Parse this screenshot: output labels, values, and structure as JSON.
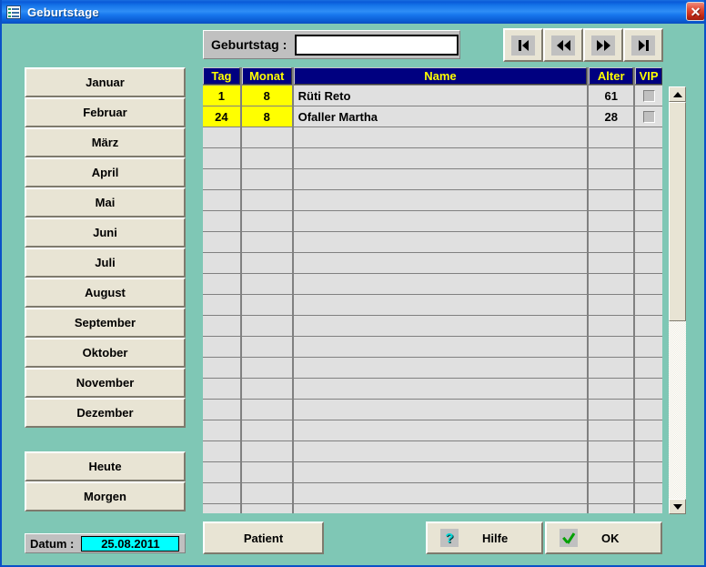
{
  "window": {
    "title": "Geburtstage",
    "icon": "list-icon",
    "close_label": "✕",
    "bg_color": "#7fc7b5",
    "titlebar_color": "#0a5ad8"
  },
  "search": {
    "label": "Geburtstag :",
    "value": "",
    "placeholder": ""
  },
  "nav": [
    {
      "name": "first-record-button",
      "icon": "go-first-icon"
    },
    {
      "name": "previous-record-button",
      "icon": "go-previous-icon"
    },
    {
      "name": "next-record-button",
      "icon": "go-next-icon"
    },
    {
      "name": "last-record-button",
      "icon": "go-last-icon"
    }
  ],
  "months": [
    "Januar",
    "Februar",
    "März",
    "April",
    "Mai",
    "Juni",
    "Juli",
    "August",
    "September",
    "Oktober",
    "November",
    "Dezember"
  ],
  "day_buttons": [
    "Heute",
    "Morgen"
  ],
  "datum": {
    "label": "Datum :",
    "value": "25.08.2011",
    "field_color": "#00ffff"
  },
  "table": {
    "header_bg": "#000080",
    "header_fg": "#ffff00",
    "highlight_color": "#ffff00",
    "columns": [
      "Tag",
      "Monat",
      "Name",
      "Alter",
      "VIP"
    ],
    "rows": [
      {
        "tag": "1",
        "monat": "8",
        "name": "Rüti Reto",
        "alter": "61",
        "vip": false,
        "highlight": true
      },
      {
        "tag": "24",
        "monat": "8",
        "name": "Ofaller Martha",
        "alter": "28",
        "vip": false,
        "highlight": true
      }
    ],
    "empty_row_count": 19
  },
  "scrollbar": {
    "up_label": "scroll-up",
    "down_label": "scroll-down",
    "thumb_position_percent": 0
  },
  "footer": {
    "patient_label": "Patient",
    "hilfe_label": "Hilfe",
    "hilfe_icon": "question-mark-icon",
    "ok_label": "OK",
    "ok_icon": "green-check-icon"
  }
}
